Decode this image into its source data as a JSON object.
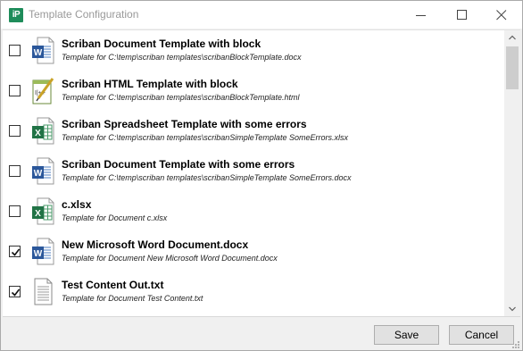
{
  "window": {
    "app_icon_text": "iP",
    "title": "Template Configuration"
  },
  "templates": [
    {
      "title": "Scriban Document Template with block",
      "subtitle": "Template for C:\\temp\\scriban templates\\scribanBlockTemplate.docx",
      "icon": "word-document-icon",
      "checked": false
    },
    {
      "title": "Scriban HTML Template with block",
      "subtitle": "Template for C:\\temp\\scriban templates\\scribanBlockTemplate.html",
      "icon": "html-editor-icon",
      "checked": false
    },
    {
      "title": "Scriban Spreadsheet Template with some errors",
      "subtitle": "Template for C:\\temp\\scriban templates\\scribanSimpleTemplate SomeErrors.xlsx",
      "icon": "excel-spreadsheet-icon",
      "checked": false
    },
    {
      "title": "Scriban Document Template with some errors",
      "subtitle": "Template for C:\\temp\\scriban templates\\scribanSimpleTemplate SomeErrors.docx",
      "icon": "word-document-icon",
      "checked": false
    },
    {
      "title": "c.xlsx",
      "subtitle": "Template for Document c.xlsx",
      "icon": "excel-spreadsheet-icon",
      "checked": false
    },
    {
      "title": "New Microsoft Word Document.docx",
      "subtitle": "Template for Document New Microsoft Word Document.docx",
      "icon": "word-document-icon",
      "checked": true
    },
    {
      "title": "Test Content Out.txt",
      "subtitle": "Template for Document Test Content.txt",
      "icon": "text-file-icon",
      "checked": true
    }
  ],
  "buttons": {
    "save_label": "Save",
    "cancel_label": "Cancel"
  },
  "colors": {
    "word_blue": "#2b579a",
    "excel_green": "#217346",
    "app_icon_green": "#1e8c5a"
  }
}
